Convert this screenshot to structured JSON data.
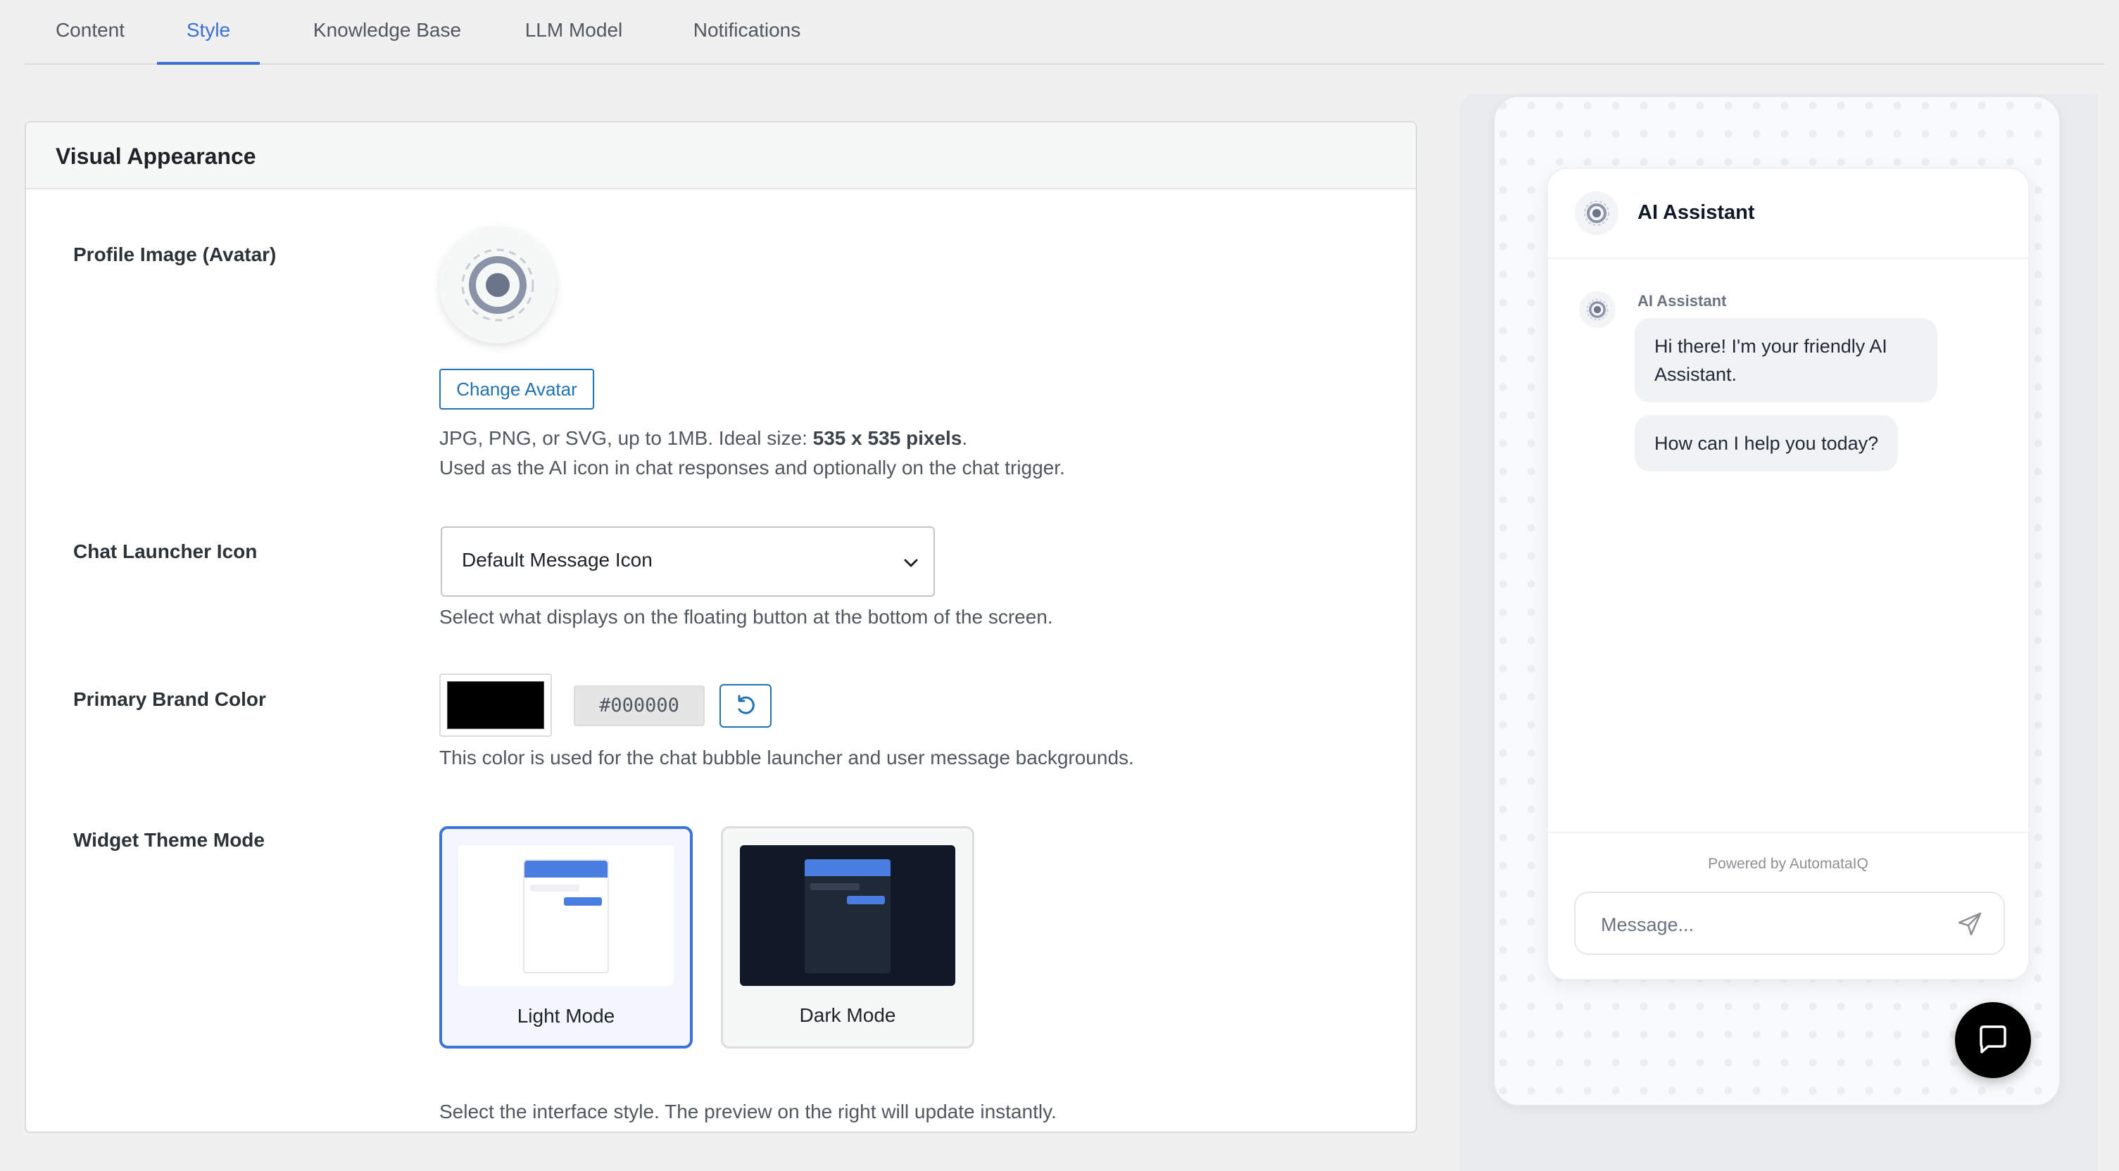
{
  "tabs": [
    {
      "label": "Content"
    },
    {
      "label": "Style",
      "active": true
    },
    {
      "label": "Knowledge Base"
    },
    {
      "label": "LLM Model"
    },
    {
      "label": "Notifications"
    }
  ],
  "section": {
    "title": "Visual Appearance"
  },
  "avatar": {
    "label": "Profile Image (Avatar)",
    "button": "Change Avatar",
    "help_prefix": "JPG, PNG, or SVG, up to 1MB. Ideal size: ",
    "help_bold": "535 x 535 pixels",
    "help_suffix": ".",
    "help_line2": "Used as the AI icon in chat responses and optionally on the chat trigger."
  },
  "launcher_icon": {
    "label": "Chat Launcher Icon",
    "selected": "Default Message Icon",
    "help": "Select what displays on the floating button at the bottom of the screen."
  },
  "brand_color": {
    "label": "Primary Brand Color",
    "value": "#000000",
    "help": "This color is used for the chat bubble launcher and user message backgrounds."
  },
  "theme": {
    "label": "Widget Theme Mode",
    "options": [
      {
        "label": "Light Mode",
        "selected": true
      },
      {
        "label": "Dark Mode",
        "selected": false
      }
    ],
    "help": "Select the interface style. The preview on the right will update instantly."
  },
  "preview": {
    "title": "AI Assistant",
    "sender": "AI Assistant",
    "messages": [
      {
        "line1": "Hi there! I'm your friendly AI",
        "line2": "Assistant."
      },
      {
        "line1": "How can I help you today?"
      }
    ],
    "powered_by": "Powered by AutomataIQ",
    "input_placeholder": "Message..."
  },
  "colors": {
    "accent": "#3b6fd6",
    "link": "#2271b1",
    "brand": "#000000"
  }
}
